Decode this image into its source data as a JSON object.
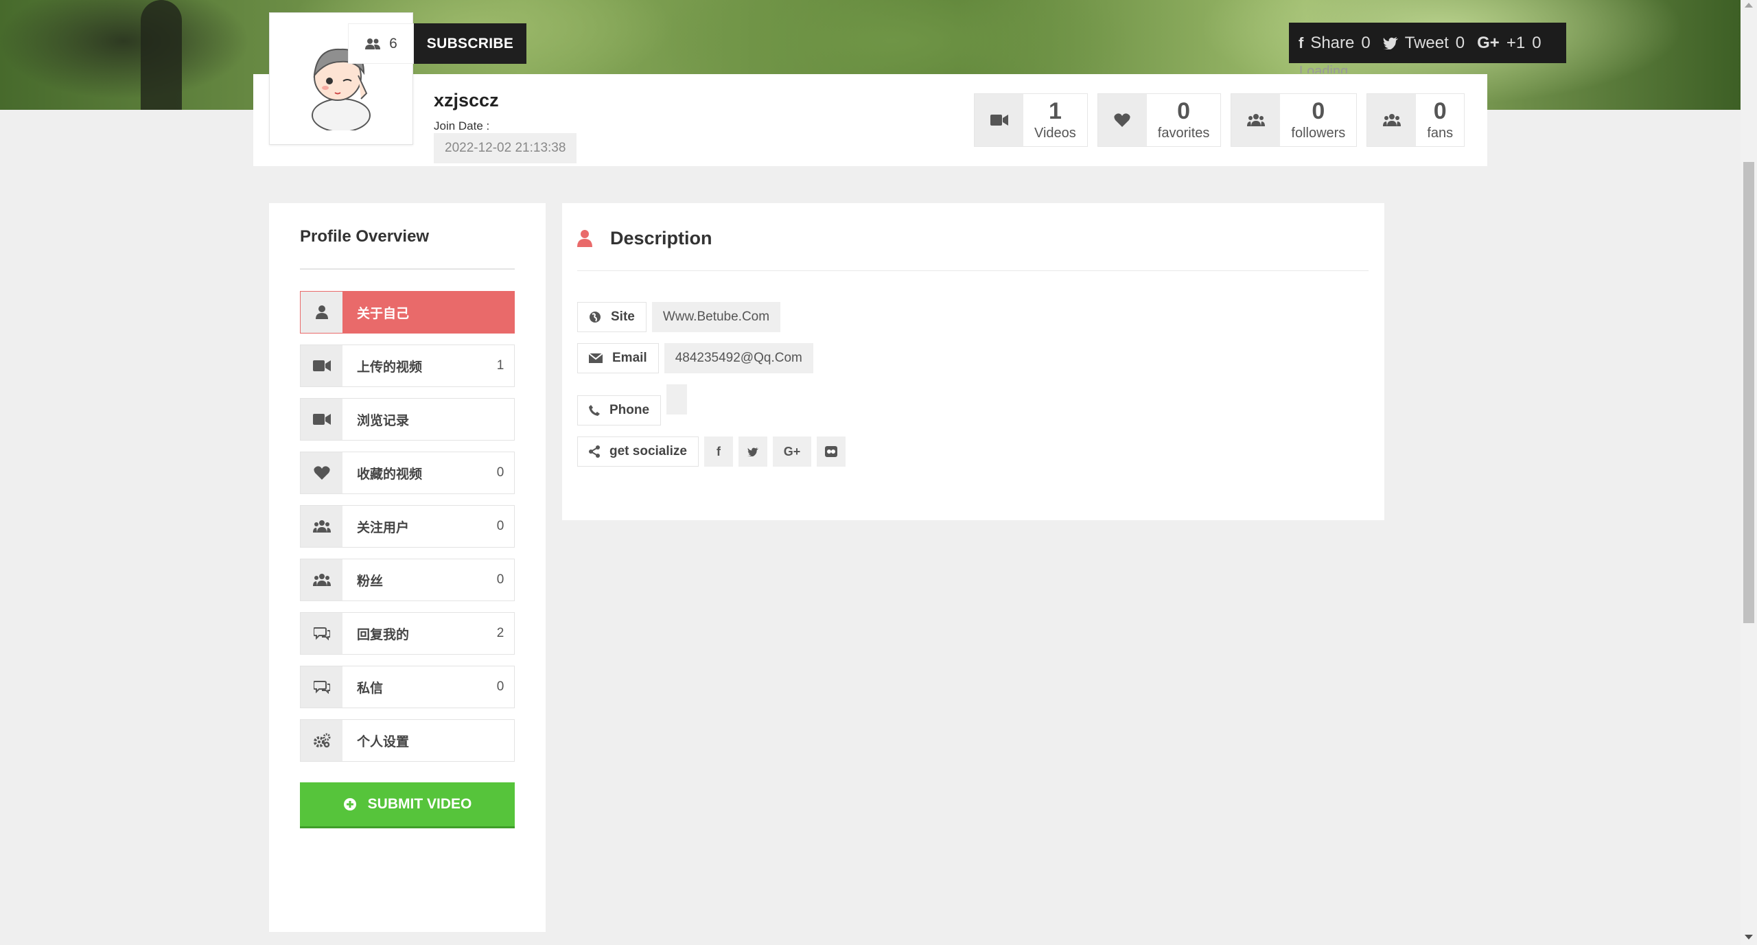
{
  "profile": {
    "username": "xzjsccz",
    "join_label": "Join Date :",
    "join_date": "2022-12-02 21:13:38",
    "subscriber_count": "6",
    "subscribe_label": "SUBSCRIBE"
  },
  "stats": [
    {
      "icon": "video-camera-icon",
      "value": "1",
      "label": "Videos"
    },
    {
      "icon": "heart-icon",
      "value": "0",
      "label": "favorites"
    },
    {
      "icon": "users-icon",
      "value": "0",
      "label": "followers"
    },
    {
      "icon": "users-icon",
      "value": "0",
      "label": "fans"
    }
  ],
  "share": {
    "share_label": "Share",
    "share_count": "0",
    "tweet_label": "Tweet",
    "tweet_count": "0",
    "gplus_label": "+1",
    "gplus_count": "0",
    "loading_text": "Loading..."
  },
  "sidebar": {
    "title": "Profile Overview",
    "items": [
      {
        "label": "关于自己",
        "count": "",
        "icon": "user-icon"
      },
      {
        "label": "上传的视频",
        "count": "1",
        "icon": "video-camera-icon"
      },
      {
        "label": "浏览记录",
        "count": "",
        "icon": "video-camera-icon"
      },
      {
        "label": "收藏的视频",
        "count": "0",
        "icon": "heart-icon"
      },
      {
        "label": "关注用户",
        "count": "0",
        "icon": "users-icon"
      },
      {
        "label": "粉丝",
        "count": "0",
        "icon": "users-icon"
      },
      {
        "label": "回复我的",
        "count": "2",
        "icon": "comments-icon"
      },
      {
        "label": "私信",
        "count": "0",
        "icon": "comments-icon"
      },
      {
        "label": "个人设置",
        "count": "",
        "icon": "gears-icon"
      }
    ],
    "submit_label": "SUBMIT VIDEO"
  },
  "description": {
    "title": "Description",
    "site_label": "Site",
    "site_value": "Www.Betube.Com",
    "email_label": "Email",
    "email_value": "484235492@Qq.Com",
    "phone_label": "Phone",
    "phone_value": "",
    "social_label": "get socialize",
    "social_icons": [
      "f",
      "t",
      "G+",
      "flickr"
    ]
  },
  "colors": {
    "accent_red": "#e96a6a",
    "submit_green": "#56c43b",
    "dark": "#1f1f1f"
  }
}
